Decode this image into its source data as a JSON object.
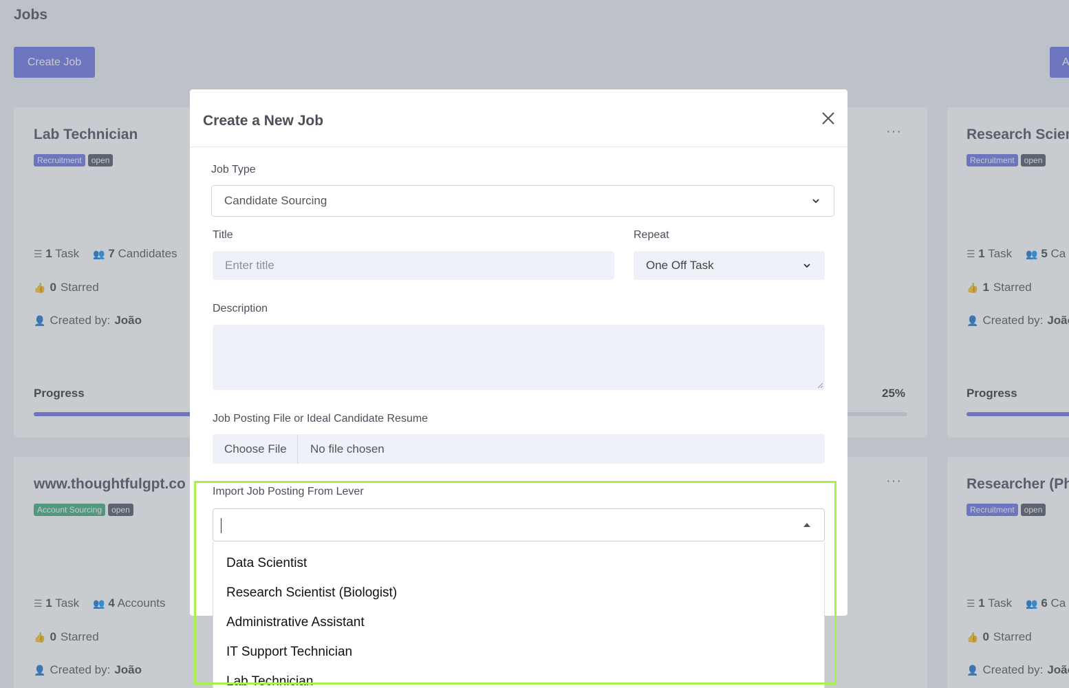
{
  "page": {
    "title": "Jobs",
    "create_button": "Create Job",
    "right_button_initial": "A"
  },
  "cards": [
    {
      "title": "Lab Technician",
      "badges": [
        "Recruitment",
        "open"
      ],
      "tasks_num": "1",
      "tasks_label": "Task",
      "count_num": "7",
      "count_label": "Candidates",
      "starred_num": "0",
      "starred_label": "Starred",
      "created_label": "Created by:",
      "created_by": "João",
      "progress_label": "Progress",
      "progress_value": 0.4
    },
    {
      "title": "Research Scien",
      "badges": [
        "Recruitment",
        "open"
      ],
      "tasks_num": "1",
      "tasks_label": "Task",
      "count_num": "5",
      "count_label": "Ca",
      "starred_num": "1",
      "starred_label": "Starred",
      "created_label": "Created by:",
      "created_by": "João",
      "progress_label": "Progress",
      "progress_value": 1.0
    },
    {
      "title": "www.thoughtfulgpt.co",
      "badges": [
        "Account Sourcing",
        "open"
      ],
      "tasks_num": "1",
      "tasks_label": "Task",
      "count_num": "4",
      "count_label": "Accounts",
      "starred_num": "0",
      "starred_label": "Starred",
      "created_label": "Created by:",
      "created_by": "João"
    },
    {
      "title": "Researcher (Ph",
      "badges": [
        "Recruitment",
        "open"
      ],
      "tasks_num": "1",
      "tasks_label": "Task",
      "count_num": "6",
      "count_label": "Ca",
      "starred_num": "0",
      "starred_label": "Starred",
      "created_label": "Created by:",
      "created_by": "João"
    }
  ],
  "middle_card": {
    "progress_pct": "25%"
  },
  "modal": {
    "title": "Create a New Job",
    "job_type_label": "Job Type",
    "job_type_value": "Candidate Sourcing",
    "title_label": "Title",
    "title_placeholder": "Enter title",
    "repeat_label": "Repeat",
    "repeat_value": "One Off Task",
    "description_label": "Description",
    "file_label": "Job Posting File or Ideal Candidate Resume",
    "file_button": "Choose File",
    "file_status": "No file chosen",
    "lever_label": "Import Job Posting From Lever",
    "lever_options": [
      "Data Scientist",
      "Research Scientist (Biologist)",
      "Administrative Assistant",
      "IT Support Technician",
      "Lab Technician"
    ]
  },
  "colors": {
    "accent": "#6d74e4",
    "highlight": "#a8f04a",
    "badge_account": "#3fae7c",
    "badge_open": "#555a64"
  }
}
